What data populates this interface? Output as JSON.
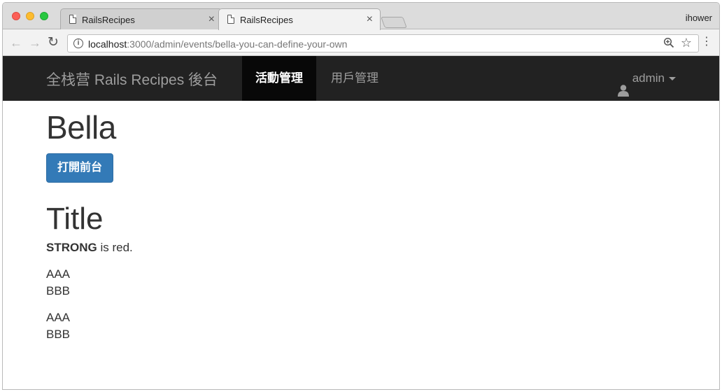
{
  "browser": {
    "tabs": [
      {
        "title": "RailsRecipes",
        "close": "×"
      },
      {
        "title": "RailsRecipes",
        "close": "×"
      }
    ],
    "profile_name": "ihower",
    "url_host": "localhost",
    "url_rest": ":3000/admin/events/bella-you-can-define-your-own",
    "info_glyph": "i"
  },
  "navbar": {
    "brand": "全栈营 Rails Recipes 後台",
    "items": [
      {
        "label": "活動管理",
        "active": true
      },
      {
        "label": "用戶管理",
        "active": false
      }
    ],
    "user_label": "admin"
  },
  "content": {
    "event_title": "Bella",
    "open_button": "打開前台",
    "section_title": "Title",
    "strong_text": "STRONG",
    "strong_rest": " is red.",
    "lines": [
      "AAA",
      "BBB",
      "AAA",
      "BBB"
    ]
  },
  "colors": {
    "navbar_bg": "#222222",
    "navbar_active_bg": "#080808",
    "button_primary": "#337ab7",
    "text": "#333333"
  },
  "icons": [
    "back-arrow-icon",
    "forward-arrow-icon",
    "reload-icon",
    "info-icon",
    "zoom-icon",
    "star-icon",
    "menu-icon",
    "user-icon",
    "caret-down-icon",
    "page-icon",
    "close-icon"
  ]
}
